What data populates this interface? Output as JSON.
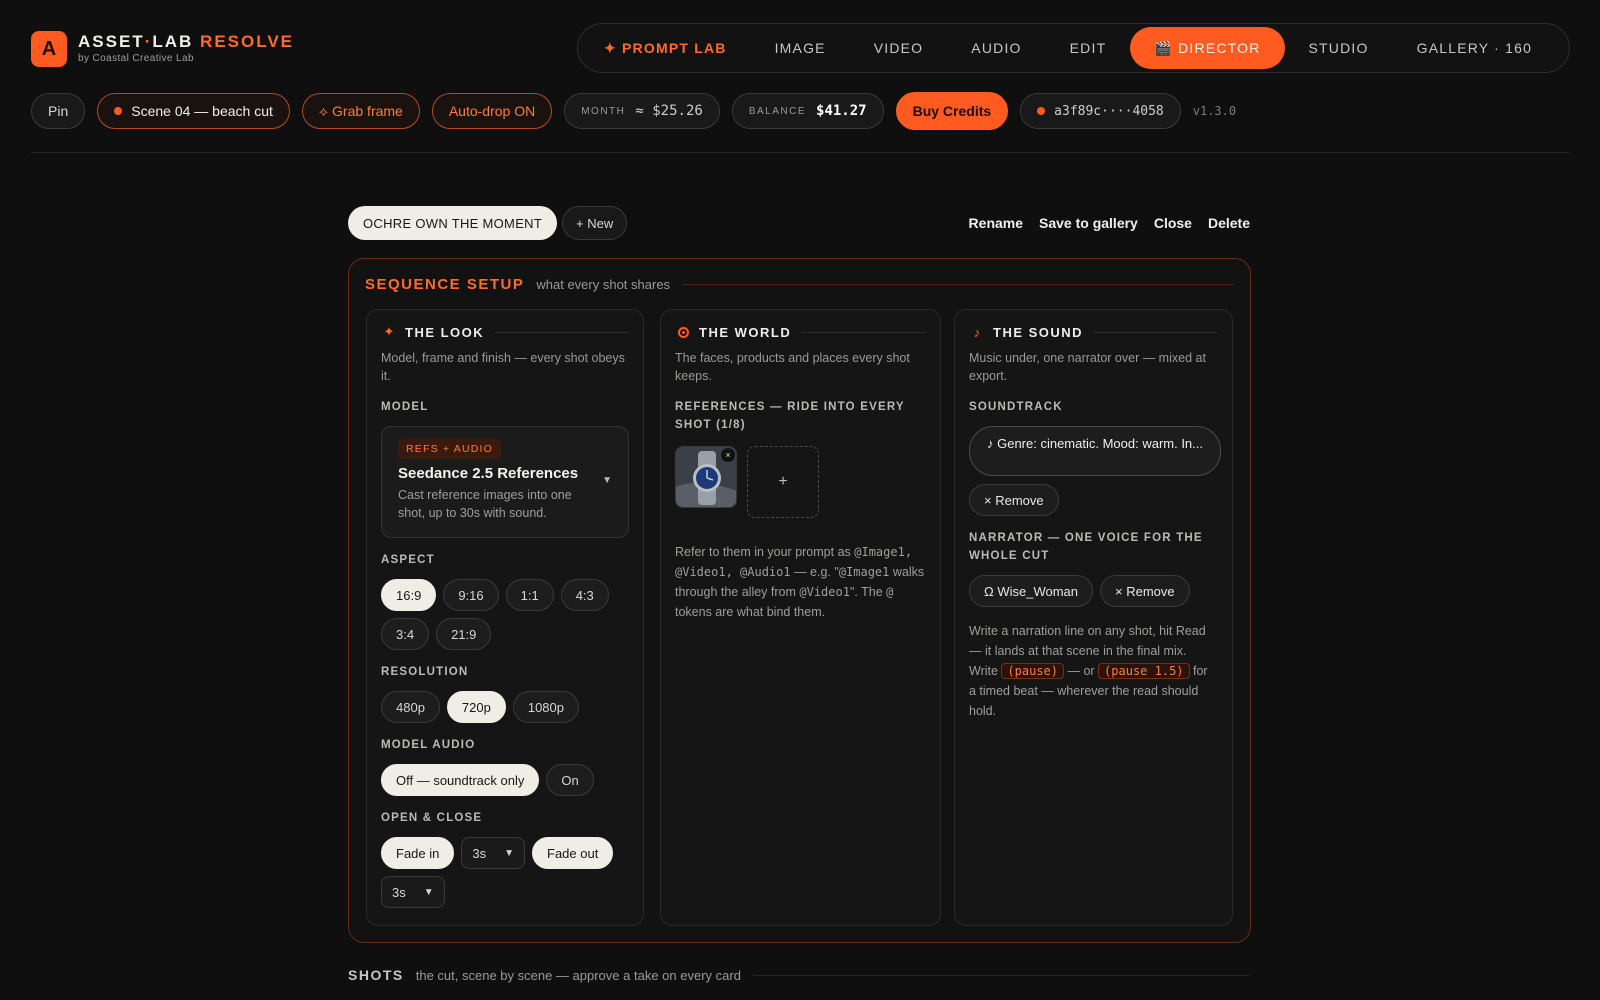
{
  "brand": {
    "logo_letter": "A",
    "name_part1": "ASSET",
    "name_part2": "LAB",
    "name_accent": "RESOLVE",
    "subtitle": "by Coastal Creative Lab"
  },
  "nav": {
    "prompt_lab": "✦ PROMPT LAB",
    "image": "IMAGE",
    "video": "VIDEO",
    "audio": "AUDIO",
    "edit": "EDIT",
    "director": "🎬 DIRECTOR",
    "studio": "STUDIO",
    "gallery": "GALLERY · 160"
  },
  "toolbar": {
    "pin": "Pin",
    "scene": "Scene 04 — beach cut",
    "grab_frame": "⟡ Grab frame",
    "auto_drop": "Auto-drop ON",
    "month_label": "MONTH",
    "month_value": "≈ $25.26",
    "balance_label": "BALANCE",
    "balance_value": "$41.27",
    "buy_credits": "Buy Credits",
    "account_id": "a3f89c····4058",
    "version": "v1.3.0"
  },
  "project": {
    "title": "OCHRE OWN THE MOMENT",
    "new_label": "+ New",
    "rename": "Rename",
    "save_to_gallery": "Save to gallery",
    "close": "Close",
    "delete": "Delete"
  },
  "setup": {
    "title": "SEQUENCE SETUP",
    "subtitle": "what every shot shares",
    "look": {
      "title": "THE LOOK",
      "description": "Model, frame and finish — every shot obeys it.",
      "model_label": "MODEL",
      "model_badge": "REFS + AUDIO",
      "model_name": "Seedance 2.5 References",
      "model_desc": "Cast reference images into one shot, up to 30s with sound.",
      "aspect_label": "ASPECT",
      "aspect_options": [
        "16:9",
        "9:16",
        "1:1",
        "4:3",
        "3:4",
        "21:9"
      ],
      "aspect_selected": "16:9",
      "resolution_label": "RESOLUTION",
      "resolution_options": [
        "480p",
        "720p",
        "1080p"
      ],
      "resolution_selected": "720p",
      "model_audio_label": "MODEL AUDIO",
      "audio_off": "Off — soundtrack only",
      "audio_on": "On",
      "open_close_label": "OPEN & CLOSE",
      "fade_in": "Fade in",
      "fade_in_duration": "3s",
      "fade_out": "Fade out",
      "fade_out_duration": "3s"
    },
    "world": {
      "title": "THE WORLD",
      "description": "The faces, products and places every shot keeps.",
      "refs_label": "REFERENCES — RIDE INTO EVERY SHOT (1/8)",
      "ref_remove": "×",
      "ref_add": "+",
      "help_1": "Refer to them in your prompt as ",
      "help_2": "@Image1, @Video1, @Audio1",
      "help_3": " — e.g. \"",
      "help_4": "@Image1",
      "help_5": " walks through the alley from ",
      "help_6": "@Video1",
      "help_7": "\". The ",
      "help_8": "@",
      "help_9": " tokens are what bind them."
    },
    "sound": {
      "title": "THE SOUND",
      "description": "Music under, one narrator over — mixed at export.",
      "soundtrack_label": "SOUNDTRACK",
      "soundtrack_value": "♪ Genre: cinematic. Mood: warm. In...",
      "remove": "× Remove",
      "narrator_label": "NARRATOR — ONE VOICE FOR THE WHOLE CUT",
      "voice": "Ω Wise_Woman",
      "narr_remove": "× Remove",
      "help_1": "Write a narration line on any shot, hit Read — it lands at that scene in the final mix. Write ",
      "code_1": "(pause)",
      "help_2": " — or ",
      "code_2": "(pause 1.5)",
      "help_3": " for a timed beat — wherever the read should hold."
    }
  },
  "shots": {
    "title": "SHOTS",
    "subtitle": "the cut, scene by scene — approve a take on every card"
  },
  "colors": {
    "accent": "#ff5a1f",
    "background": "#0f0f10",
    "panel_border": "#6b2a12"
  }
}
